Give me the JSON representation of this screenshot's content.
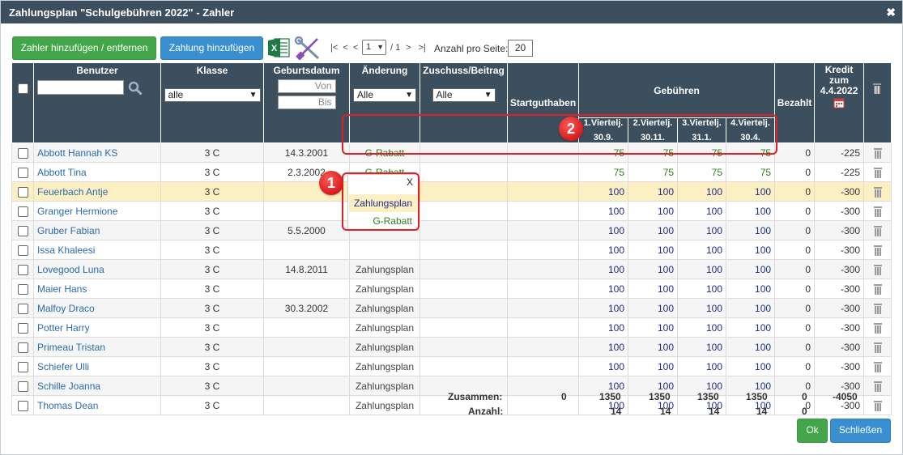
{
  "window": {
    "title": "Zahlungsplan \"Schulgebühren 2022\" - Zahler",
    "close_glyph": "✖"
  },
  "toolbar": {
    "add_remove_payer_label": "Zahler hinzufügen / entfernen",
    "add_payment_label": "Zahlung hinzufügen",
    "excel_icon": "excel-export-icon",
    "tools_icon": "tools-icon",
    "pager_first": "|<",
    "pager_prev": "<",
    "pager_prev2": "<",
    "pager_page": "1",
    "pager_total": "/ 1",
    "pager_next": ">",
    "pager_last": ">|",
    "per_page_label": "Anzahl pro Seite:",
    "per_page_value": "20"
  },
  "columns": {
    "user": "Benutzer",
    "class": "Klasse",
    "birthdate": "Geburtsdatum",
    "change": "Änderung",
    "subsidy": "Zuschuss/Beitrag",
    "start_credit": "Startguthaben",
    "fees": "Gebühren",
    "q1": "1.Viertelj.",
    "q1_date": "30.9.",
    "q2": "2.Viertelj.",
    "q2_date": "30.11.",
    "q3": "3.Viertelj.",
    "q3_date": "31.1.",
    "q4": "4.Viertelj.",
    "q4_date": "30.4.",
    "paid": "Bezahlt",
    "credit": "Kredit zum 4.4.2022"
  },
  "filters": {
    "user_search_value": "",
    "class_select": "alle",
    "birth_from_placeholder": "Von",
    "birth_to_placeholder": "Bis",
    "change_select": "Alle",
    "subsidy_select": "Alle"
  },
  "rows": [
    {
      "name": "Abbott Hannah KS",
      "class": "3 C",
      "birth": "14.3.2001",
      "change": "G-Rabatt",
      "q1": "75",
      "q2": "75",
      "q3": "75",
      "q4": "75",
      "paid": "0",
      "credit": "-225"
    },
    {
      "name": "Abbott Tina",
      "class": "3 C",
      "birth": "2.3.2002",
      "change": "G-Rabatt",
      "q1": "75",
      "q2": "75",
      "q3": "75",
      "q4": "75",
      "paid": "0",
      "credit": "-225"
    },
    {
      "name": "Feuerbach Antje",
      "class": "3 C",
      "birth": "",
      "change": "Zahlungsplan",
      "q1": "100",
      "q2": "100",
      "q3": "100",
      "q4": "100",
      "paid": "0",
      "credit": "-300"
    },
    {
      "name": "Granger Hermione",
      "class": "3 C",
      "birth": "",
      "change": "",
      "q1": "100",
      "q2": "100",
      "q3": "100",
      "q4": "100",
      "paid": "0",
      "credit": "-300"
    },
    {
      "name": "Gruber Fabian",
      "class": "3 C",
      "birth": "5.5.2000",
      "change": "",
      "q1": "100",
      "q2": "100",
      "q3": "100",
      "q4": "100",
      "paid": "0",
      "credit": "-300"
    },
    {
      "name": "Issa Khaleesi",
      "class": "3 C",
      "birth": "",
      "change": "",
      "q1": "100",
      "q2": "100",
      "q3": "100",
      "q4": "100",
      "paid": "0",
      "credit": "-300"
    },
    {
      "name": "Lovegood Luna",
      "class": "3 C",
      "birth": "14.8.2011",
      "change": "Zahlungsplan",
      "q1": "100",
      "q2": "100",
      "q3": "100",
      "q4": "100",
      "paid": "0",
      "credit": "-300"
    },
    {
      "name": "Maier Hans",
      "class": "3 C",
      "birth": "",
      "change": "Zahlungsplan",
      "q1": "100",
      "q2": "100",
      "q3": "100",
      "q4": "100",
      "paid": "0",
      "credit": "-300"
    },
    {
      "name": "Malfoy Draco",
      "class": "3 C",
      "birth": "30.3.2002",
      "change": "Zahlungsplan",
      "q1": "100",
      "q2": "100",
      "q3": "100",
      "q4": "100",
      "paid": "0",
      "credit": "-300"
    },
    {
      "name": "Potter Harry",
      "class": "3 C",
      "birth": "",
      "change": "Zahlungsplan",
      "q1": "100",
      "q2": "100",
      "q3": "100",
      "q4": "100",
      "paid": "0",
      "credit": "-300"
    },
    {
      "name": "Primeau Tristan",
      "class": "3 C",
      "birth": "",
      "change": "Zahlungsplan",
      "q1": "100",
      "q2": "100",
      "q3": "100",
      "q4": "100",
      "paid": "0",
      "credit": "-300"
    },
    {
      "name": "Schiefer Ulli",
      "class": "3 C",
      "birth": "",
      "change": "Zahlungsplan",
      "q1": "100",
      "q2": "100",
      "q3": "100",
      "q4": "100",
      "paid": "0",
      "credit": "-300"
    },
    {
      "name": "Schille Joanna",
      "class": "3 C",
      "birth": "",
      "change": "Zahlungsplan",
      "q1": "100",
      "q2": "100",
      "q3": "100",
      "q4": "100",
      "paid": "0",
      "credit": "-300"
    },
    {
      "name": "Thomas Dean",
      "class": "3 C",
      "birth": "",
      "change": "Zahlungsplan",
      "q1": "100",
      "q2": "100",
      "q3": "100",
      "q4": "100",
      "paid": "0",
      "credit": "-300"
    }
  ],
  "dropdown": {
    "clear_label": "X",
    "option_1": "Zahlungsplan",
    "option_2": "G-Rabatt"
  },
  "totals": {
    "sum_label": "Zusammen:",
    "sum_start": "0",
    "sum_q1": "1350",
    "sum_q2": "1350",
    "sum_q3": "1350",
    "sum_q4": "1350",
    "sum_paid": "0",
    "sum_credit": "-4050",
    "count_label": "Anzahl:",
    "count_q1": "14",
    "count_q2": "14",
    "count_q3": "14",
    "count_q4": "14",
    "count_paid": "0"
  },
  "annotations": {
    "badge_1": "1",
    "badge_2": "2"
  },
  "footer": {
    "ok_label": "Ok",
    "close_label": "Schließen"
  },
  "colors": {
    "header_bg": "#3c4f5e",
    "button_green": "#43a64a",
    "button_blue": "#3a8fd1",
    "highlight_row": "#fcf0c3",
    "link_blue": "#2a6ab0",
    "amount_navy": "#1f2a8a",
    "discount_green": "#2e7d1c",
    "callout_red": "#e01f26"
  }
}
